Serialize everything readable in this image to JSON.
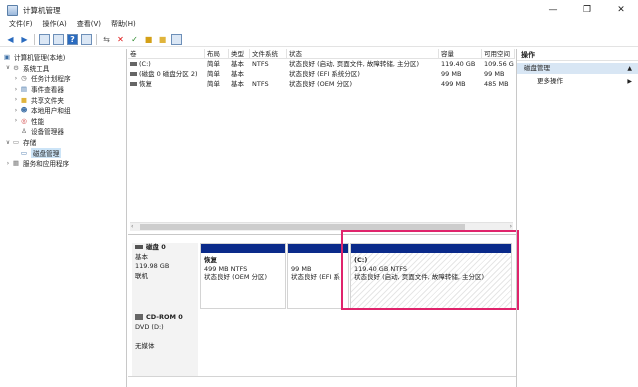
{
  "window": {
    "title": "计算机管理",
    "controls": {
      "minimize": "—",
      "maximize": "❐",
      "close": "✕"
    }
  },
  "menu": [
    "文件(F)",
    "操作(A)",
    "查看(V)",
    "帮助(H)"
  ],
  "toolbar": {
    "icons": [
      "back-arrow-icon",
      "forward-arrow-icon",
      "up-folder-icon",
      "console-tree-icon",
      "help-icon",
      "properties-icon",
      "connect-icon",
      "delete-icon",
      "check-icon",
      "properties-sheet-icon",
      "folder-icon",
      "view-icon"
    ]
  },
  "tree": {
    "root": "计算机管理(本地)",
    "items": [
      {
        "label": "系统工具",
        "indent": 1,
        "twisty": "∨",
        "icon": "tools-icon"
      },
      {
        "label": "任务计划程序",
        "indent": 2,
        "twisty": "›",
        "icon": "clock-icon"
      },
      {
        "label": "事件查看器",
        "indent": 2,
        "twisty": "›",
        "icon": "event-viewer-icon"
      },
      {
        "label": "共享文件夹",
        "indent": 2,
        "twisty": "›",
        "icon": "shared-folder-icon"
      },
      {
        "label": "本地用户和组",
        "indent": 2,
        "twisty": "›",
        "icon": "users-icon"
      },
      {
        "label": "性能",
        "indent": 2,
        "twisty": "›",
        "icon": "performance-icon"
      },
      {
        "label": "设备管理器",
        "indent": 2,
        "twisty": "",
        "icon": "device-manager-icon"
      },
      {
        "label": "存储",
        "indent": 1,
        "twisty": "∨",
        "icon": "storage-icon"
      },
      {
        "label": "磁盘管理",
        "indent": 2,
        "twisty": "",
        "icon": "disk-management-icon",
        "selected": true
      },
      {
        "label": "服务和应用程序",
        "indent": 1,
        "twisty": "›",
        "icon": "services-icon"
      }
    ]
  },
  "volume_list": {
    "columns": [
      "卷",
      "布局",
      "类型",
      "文件系统",
      "状态",
      "容量",
      "可用空间"
    ],
    "rows": [
      [
        "(C:)",
        "简单",
        "基本",
        "NTFS",
        "状态良好 (启动, 页面文件, 故障转储, 主分区)",
        "119.40 GB",
        "109.56 G"
      ],
      [
        "(磁盘 0 磁盘分区 2)",
        "简单",
        "基本",
        "",
        "状态良好 (EFI 系统分区)",
        "99 MB",
        "99 MB"
      ],
      [
        "恢复",
        "简单",
        "基本",
        "NTFS",
        "状态良好 (OEM 分区)",
        "499 MB",
        "485 MB"
      ]
    ]
  },
  "disks": [
    {
      "name": "磁盘 0",
      "type": "基本",
      "size": "119.98 GB",
      "status": "联机",
      "partitions": [
        {
          "name": "恢复",
          "detail": "499 MB NTFS",
          "status": "状态良好 (OEM 分区)"
        },
        {
          "name": "",
          "detail": "99 MB",
          "status": "状态良好 (EFI 系"
        },
        {
          "name": "(C:)",
          "detail": "119.40 GB NTFS",
          "status": "状态良好 (启动, 页面文件, 故障转储, 主分区)"
        }
      ]
    },
    {
      "name": "CD-ROM 0",
      "type": "DVD (D:)",
      "size": "",
      "status": "无媒体"
    }
  ],
  "actions": {
    "header": "操作",
    "section": "磁盘管理",
    "more": "更多操作"
  },
  "colors": {
    "partition_bar": "#0a2a8a",
    "highlight": "#e0246c",
    "selection": "#cce4f7"
  }
}
